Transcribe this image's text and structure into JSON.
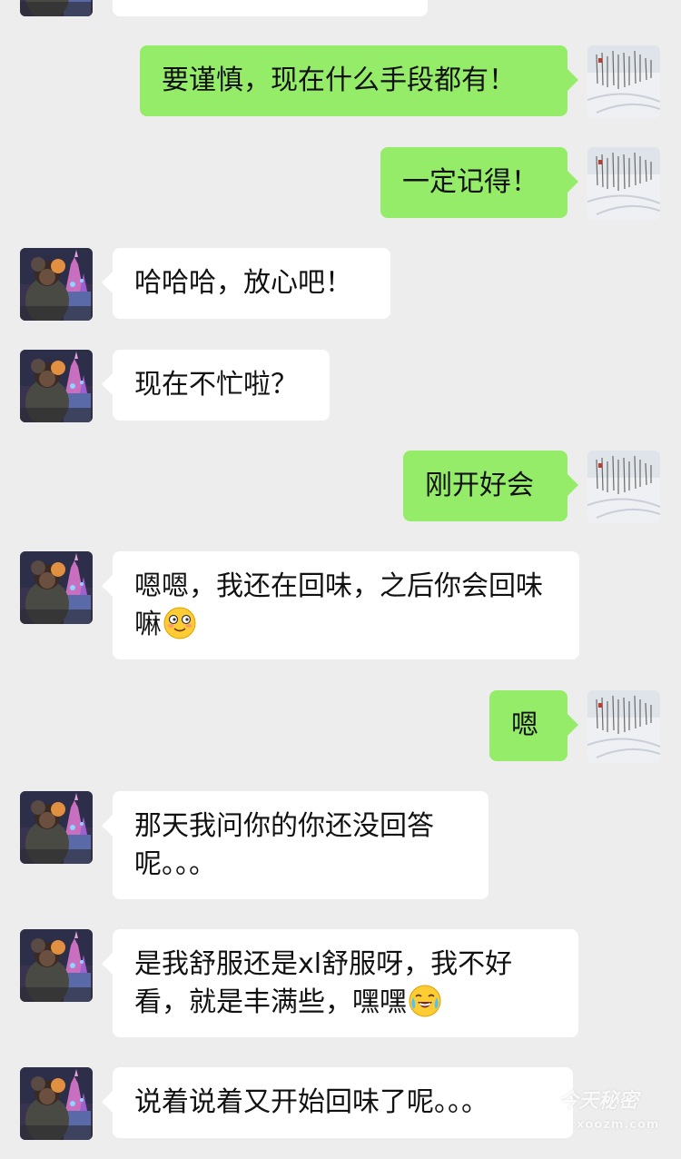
{
  "messages": [
    {
      "side": "left",
      "text": ""
    },
    {
      "side": "right",
      "text": "要谨慎，现在什么手段都有！"
    },
    {
      "side": "right",
      "text": "一定记得！"
    },
    {
      "side": "left",
      "text": "哈哈哈，放心吧！"
    },
    {
      "side": "left",
      "text": "现在不忙啦？"
    },
    {
      "side": "right",
      "text": "刚开好会"
    },
    {
      "side": "left",
      "text": "嗯嗯，我还在回味，之后你会回味嘛",
      "emoji": "smiling-blush-emoji"
    },
    {
      "side": "right",
      "text": "嗯"
    },
    {
      "side": "left",
      "text": "那天我问你的你还没回答呢。。。"
    },
    {
      "side": "left",
      "text": "是我舒服还是xl舒服呀，我不好看，就是丰满些，嘿嘿",
      "emoji": "laughing-tears-emoji"
    },
    {
      "side": "left",
      "text": "说着说着又开始回味了呢。。。"
    }
  ],
  "avatars": {
    "left": "castle-night-avatar",
    "right": "snowy-trees-avatar"
  },
  "watermark": {
    "title": "今天秘密",
    "domain": "xoozm.com"
  },
  "colors": {
    "background": "#ededed",
    "incoming_bubble": "#ffffff",
    "outgoing_bubble": "#95ec69"
  }
}
